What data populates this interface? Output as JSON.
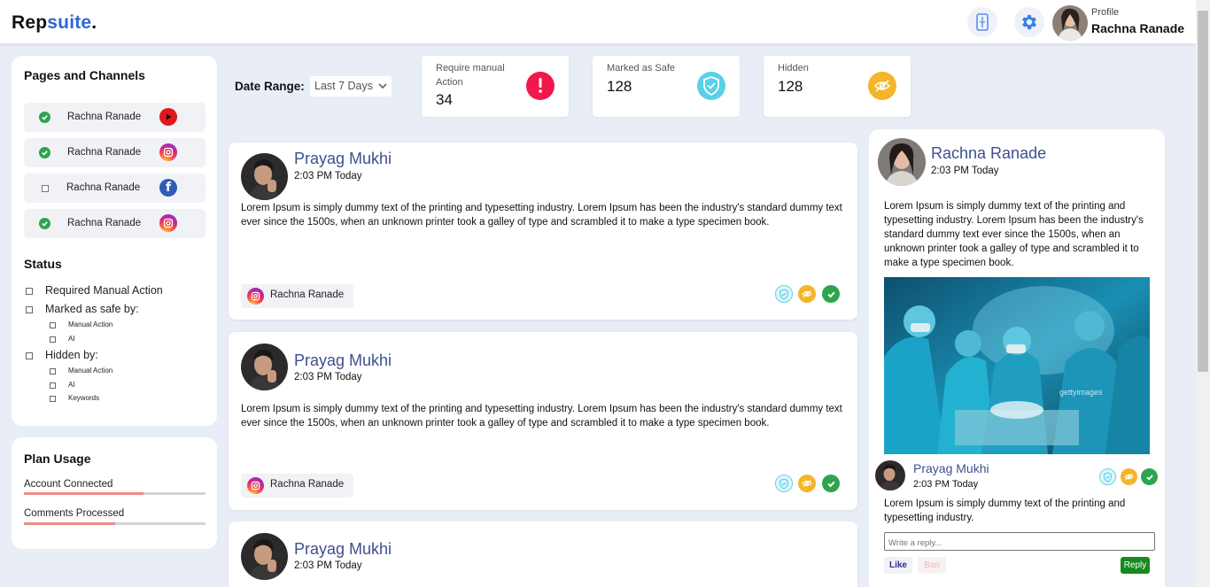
{
  "app": {
    "logo_part1": "Rep",
    "logo_part2": "suite",
    "logo_part3": "."
  },
  "header": {
    "profile_label": "Profile",
    "profile_name": "Rachna Ranade",
    "icons": [
      "phone-icon",
      "gear-icon"
    ]
  },
  "sidebar": {
    "channels_title": "Pages and Channels",
    "channels": [
      {
        "name": "Rachna Ranade",
        "platform": "youtube",
        "checked": true
      },
      {
        "name": "Rachna Ranade",
        "platform": "instagram",
        "checked": true
      },
      {
        "name": "Rachna Ranade",
        "platform": "facebook",
        "checked": false
      },
      {
        "name": "Rachna Ranade",
        "platform": "instagram",
        "checked": true
      }
    ],
    "status_title": "Status",
    "status": {
      "required": "Required Manual Action",
      "safe_by": "Marked as safe by:",
      "safe_manual": "Manual Action",
      "safe_ai": "AI",
      "hidden_by": "Hidden by:",
      "hidden_manual": "Manual Action",
      "hidden_ai": "AI",
      "hidden_keywords": "Keywords"
    },
    "usage_title": "Plan Usage",
    "usage": [
      {
        "label": "Account Connected",
        "fraction": 0.66
      },
      {
        "label": "Comments Processed",
        "fraction": 0.5
      }
    ]
  },
  "filters": {
    "date_range_label": "Date Range:",
    "date_range_value": "Last 7 Days"
  },
  "stats": [
    {
      "label": "Require manual Action",
      "value": "34",
      "color": "#f2174d",
      "icon": "exclamation-icon"
    },
    {
      "label": "Marked as Safe",
      "value": "128",
      "color": "#5ad0e6",
      "icon": "shield-check-icon"
    },
    {
      "label": "Hidden",
      "value": "128",
      "color": "#f4b528",
      "icon": "eye-off-icon"
    }
  ],
  "posts": [
    {
      "author": "Prayag Mukhi",
      "time": "2:03 PM Today",
      "text": "Lorem Ipsum is simply dummy text of the printing and typesetting industry. Lorem Ipsum has been the industry's standard dummy text ever since the 1500s, when an unknown printer took a galley of type and scrambled it to make a type specimen book.",
      "channel": "Rachna Ranade"
    },
    {
      "author": "Prayag Mukhi",
      "time": "2:03 PM Today",
      "text": "Lorem Ipsum is simply dummy text of the printing and typesetting industry. Lorem Ipsum has been the industry's standard dummy text ever since the 1500s, when an unknown printer took a galley of type and scrambled it to make a type specimen book.",
      "channel": "Rachna Ranade"
    },
    {
      "author": "Prayag Mukhi",
      "time": "2:03 PM Today",
      "text": "",
      "channel": ""
    }
  ],
  "detail": {
    "author": "Rachna Ranade",
    "time": "2:03 PM Today",
    "text": "Lorem Ipsum is simply dummy text of the printing and typesetting industry. Lorem Ipsum has been the industry's standard dummy text ever since the 1500s, when an unknown printer took a galley of type and scrambled it to make a type specimen book.",
    "image_watermark": "gettyimages",
    "comment": {
      "author": "Prayag Mukhi",
      "time": "2:03 PM Today",
      "text": "Lorem Ipsum is simply dummy text of the printing and typesetting industry."
    },
    "reply_placeholder": "Write a reply...",
    "like_label": "Like",
    "ban_label": "Ban",
    "reply_label": "Reply"
  },
  "colors": {
    "accent": "#3e4f8e",
    "logo_blue": "#2f66d6",
    "success": "#2ea44f",
    "warning": "#f4b528",
    "danger": "#f2174d",
    "safe": "#5ad0e6"
  }
}
